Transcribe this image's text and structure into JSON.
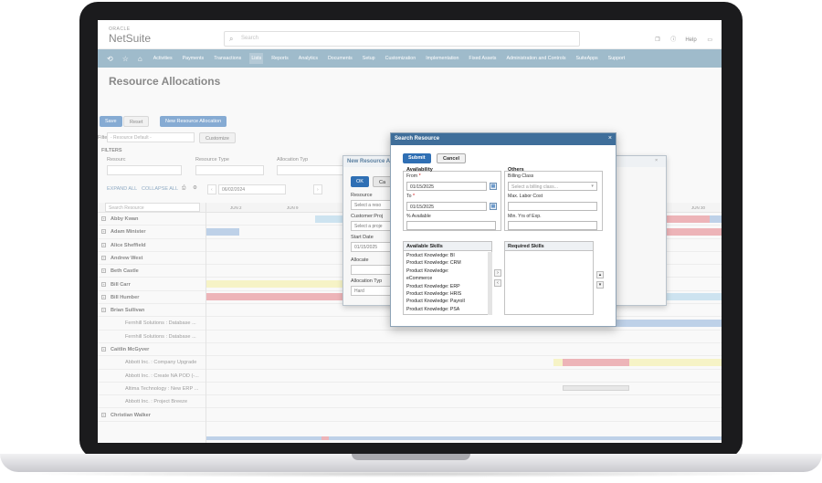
{
  "header": {
    "logo_top": "ORACLE",
    "logo_main": "NetSuite",
    "search_placeholder": "Search",
    "help": "Help"
  },
  "nav": {
    "items": [
      "Activities",
      "Payments",
      "Transactions",
      "Lists",
      "Reports",
      "Analytics",
      "Documents",
      "Setup",
      "Customization",
      "Implementation",
      "Fixed Assets",
      "Administration and Controls",
      "SuiteApps",
      "Support"
    ],
    "active": "Lists"
  },
  "page": {
    "title": "Resource Allocations",
    "save": "Save",
    "reset": "Reset",
    "new_alloc": "New Resource Allocation",
    "filter_label": "Filter",
    "filter_value": "- Resource Default -",
    "customize": "Customize",
    "filters": "FILTERS",
    "resource_label": "Resourc",
    "resource_type_label": "Resource Type",
    "alloc_type_label": "Allocation Typ",
    "expand": "EXPAND ALL",
    "collapse": "COLLAPSE ALL",
    "date": "06/02/2024",
    "search_res_ph": "Search Resource",
    "col_jun2": "JUN 2",
    "col_jun9": "JUN 9",
    "col_jun30": "JUN 30"
  },
  "rows": [
    {
      "name": "Abby Kwan",
      "type": "group"
    },
    {
      "name": "Adam Minister",
      "type": "group"
    },
    {
      "name": "Alice Sheffield",
      "type": "group"
    },
    {
      "name": "Andrew West",
      "type": "group"
    },
    {
      "name": "Beth Castle",
      "type": "group"
    },
    {
      "name": "Bill Carr",
      "type": "group"
    },
    {
      "name": "Bill Humber",
      "type": "group"
    },
    {
      "name": "Brian Sullivan",
      "type": "group"
    },
    {
      "name": "Fernhill Solutions : Database ...",
      "type": "sub"
    },
    {
      "name": "Fernhill Solutions : Database ...",
      "type": "sub"
    },
    {
      "name": "Caitlin McGyver",
      "type": "group"
    },
    {
      "name": "Abbott Inc. : Company Upgrade",
      "type": "sub"
    },
    {
      "name": "Abbott Inc. : Create NA POD (-...",
      "type": "sub"
    },
    {
      "name": "Altima Technology : New ERP ...",
      "type": "sub"
    },
    {
      "name": "Abbott Inc. : Project Breeze",
      "type": "sub"
    },
    {
      "name": "Christian Walker",
      "type": "group"
    }
  ],
  "behind_dialog": {
    "title": "New Resource A",
    "ok": "OK",
    "cancel_short": "Ca",
    "resource": "Resource",
    "resource_ph": "Select a reso",
    "customer": "Customer:Proj",
    "customer_ph": "Select a proje",
    "start_date": "Start Date",
    "start_value": "01/15/2025",
    "allocate": "Allocate",
    "alloc_type": "Allocation Typ",
    "alloc_value": "Hard"
  },
  "dialog": {
    "title": "Search Resource",
    "submit": "Submit",
    "cancel": "Cancel",
    "availability": "Availability",
    "from_label": "From",
    "from_value": "01/15/2025",
    "to_label": "To",
    "to_value": "01/15/2025",
    "pct_label": "% Available",
    "others": "Others",
    "billing_label": "Billing Class",
    "billing_ph": "Select a billing class...",
    "labor_label": "Max. Labor Cost",
    "exp_label": "Min. Yrs of Exp.",
    "available_skills": "Available Skills",
    "required_skills": "Required Skills",
    "skills": [
      "Product Knowledge: BI",
      "Product Knowledge: CRM",
      "Product Knowledge:",
      "eCommerce",
      "Product Knowledge: ERP",
      "Product Knowledge: HRIS",
      "Product Knowledge: Payroll",
      "Product Knowledge: PSA"
    ]
  }
}
